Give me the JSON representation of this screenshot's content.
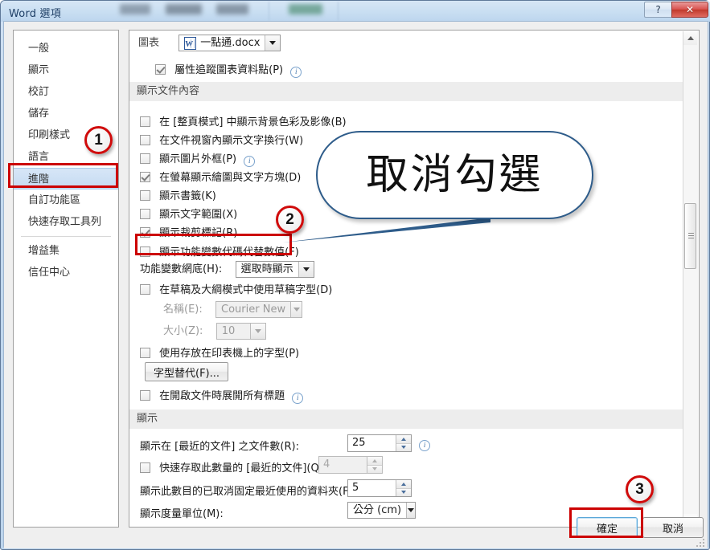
{
  "window": {
    "title": "Word 選項",
    "help_button": "?",
    "close_button": "✕"
  },
  "sidebar": {
    "items": [
      {
        "label": "一般",
        "selected": false
      },
      {
        "label": "顯示",
        "selected": false
      },
      {
        "label": "校訂",
        "selected": false
      },
      {
        "label": "儲存",
        "selected": false
      },
      {
        "label": "印刷樣式",
        "selected": false
      },
      {
        "label": "語言",
        "selected": false
      },
      {
        "label": "進階",
        "selected": true
      },
      {
        "label": "自訂功能區",
        "selected": false
      },
      {
        "label": "快速存取工具列",
        "selected": false
      },
      {
        "label": "增益集",
        "selected": false
      },
      {
        "label": "信任中心",
        "selected": false
      }
    ]
  },
  "content": {
    "chart_row": {
      "label": "圖表",
      "document_name": "一點通.docx",
      "icon": "word-document-icon",
      "dropdown_icon": "chevron-down-icon"
    },
    "chart_checkbox": {
      "label": "屬性追蹤圖表資料點(P)",
      "checked": true,
      "info_icon": "info-circle-icon"
    },
    "section_document_content": {
      "header": "顯示文件內容",
      "checkboxes": [
        {
          "label": "在 [整頁模式] 中顯示背景色彩及影像(B)",
          "checked": false,
          "info": false
        },
        {
          "label": "在文件視窗內顯示文字換行(W)",
          "checked": false,
          "info": false
        },
        {
          "label": "顯示圖片外框(P)",
          "checked": false,
          "info": true
        },
        {
          "label": "在螢幕顯示繪圖與文字方塊(D)",
          "checked": true,
          "info": false
        },
        {
          "label": "顯示書籤(K)",
          "checked": false,
          "info": false
        },
        {
          "label": "顯示文字範圍(X)",
          "checked": false,
          "info": false
        },
        {
          "label": "顯示裁剪標記(R)",
          "checked": true,
          "info": false
        },
        {
          "label": "顯示功能變數代碼代替數值(F)",
          "checked": false,
          "info": false
        }
      ],
      "field_shading": {
        "label": "功能變數網底(H):",
        "value": "選取時顯示",
        "dropdown_icon": "chevron-down-icon"
      },
      "draft_font": {
        "label": "在草稿及大綱模式中使用草稿字型(D)",
        "checked": false,
        "name_label": "名稱(E):",
        "name_value": "Courier New",
        "size_label": "大小(Z):",
        "size_value": "10",
        "disabled": true
      },
      "printer_font": {
        "label": "使用存放在印表機上的字型(P)",
        "checked": false
      },
      "font_substitution_button": "字型替代(F)...",
      "expand_headings": {
        "label": "在開啟文件時展開所有標題",
        "checked": false,
        "info": true
      }
    },
    "section_display": {
      "header": "顯示",
      "recent_docs": {
        "label": "顯示在 [最近的文件] 之文件數(R):",
        "value": "25",
        "info": true
      },
      "quick_access_recent": {
        "label": "快速存取此數量的 [最近的文件](Q):",
        "checked": false,
        "value": "4",
        "disabled": true
      },
      "unpinned_folders": {
        "label": "顯示此數目的已取消固定最近使用的資料夾(F):",
        "value": "5"
      },
      "measurement_unit": {
        "label": "顯示度量單位(M):",
        "value": "公分 (cm)",
        "dropdown_icon": "chevron-down-icon"
      }
    },
    "scrollbar": {
      "up_icon": "scroll-up-arrow-icon",
      "down_icon": "scroll-down-arrow-icon",
      "thumb": "scrollbar-thumb"
    }
  },
  "footer": {
    "ok_button": "確定",
    "cancel_button": "取消"
  },
  "annotations": {
    "badges": [
      {
        "number": "1",
        "target": "sidebar-item-advanced"
      },
      {
        "number": "2",
        "target": "field-codes-checkbox"
      },
      {
        "number": "3",
        "target": "ok-button"
      }
    ],
    "callout_text": "取消勾選",
    "highlight_color": "#cc0000",
    "callout_border_color": "#2e5c8a"
  }
}
